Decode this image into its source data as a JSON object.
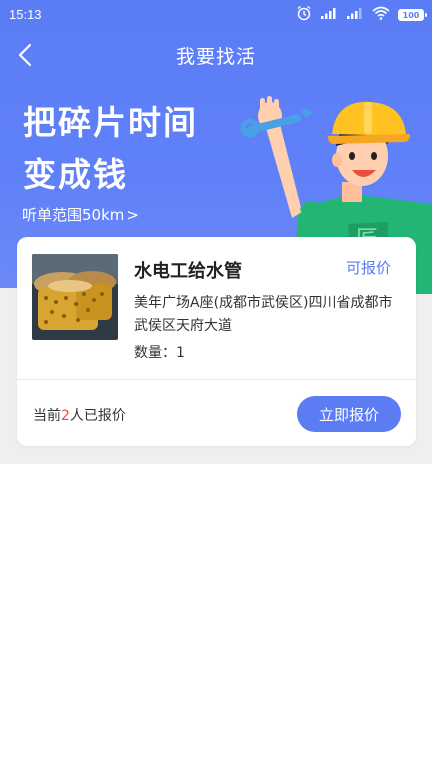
{
  "status_bar": {
    "time": "15:13",
    "battery": "100"
  },
  "nav": {
    "title": "我要找活"
  },
  "hero": {
    "title_line1": "把碎片时间",
    "title_line2": "变成钱",
    "range_text": "听单范围50km",
    "range_chevron": ">"
  },
  "job": {
    "title": "水电工给水管",
    "quote_status": "可报价",
    "address": "美年广场A座(成都市武侯区)四川省成都市武侯区天府大道",
    "quantity_label": "数量：",
    "quantity_value": "1",
    "quote_prefix": "当前",
    "quote_count": "2",
    "quote_suffix": "人已报价",
    "quote_button": "立即报价"
  },
  "colors": {
    "primary": "#5b7cf3",
    "hero_bg": "#5a7df6",
    "accent_red": "#e84a4a",
    "page_grey": "#efefef"
  }
}
